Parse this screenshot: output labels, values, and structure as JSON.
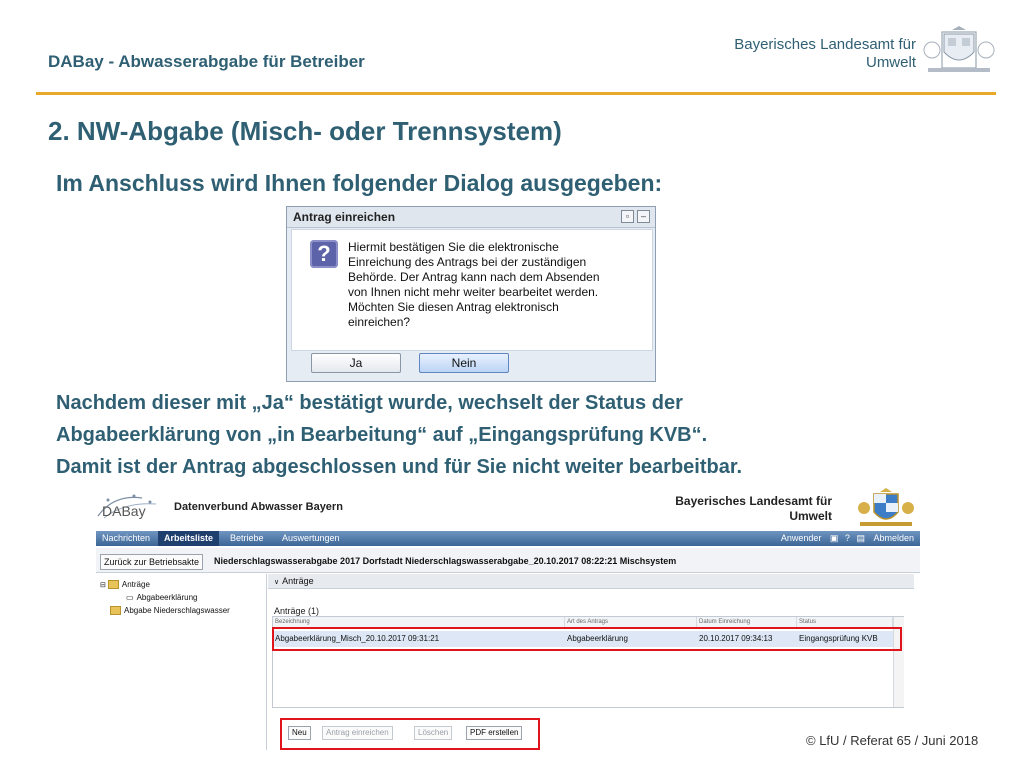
{
  "header": {
    "title": "DABay - Abwasserabgabe für Betreiber",
    "org_line1": "Bayerisches Landesamt für",
    "org_line2": "Umwelt"
  },
  "slide": {
    "heading": "2. NW-Abgabe (Misch- oder Trennsystem)",
    "intro": "Im Anschluss wird Ihnen folgender Dialog ausgegeben:",
    "para_line1": "Nachdem dieser mit „Ja“ bestätigt wurde, wechselt der Status der",
    "para_line2": "Abgabeerklärung von „in Bearbeitung“ auf „Eingangsprüfung KVB“.",
    "para_line3": "Damit ist der Antrag abgeschlossen und für Sie nicht weiter bearbeitbar."
  },
  "dialog": {
    "title": "Antrag einreichen",
    "message": "Hiermit bestätigen Sie die elektronische\nEinreichung des Antrags bei der zuständigen\nBehörde. Der Antrag kann nach dem Absenden\nvon Ihnen nicht mehr weiter bearbeitet werden.\nMöchten Sie diesen Antrag elektronisch\neinreichen?",
    "icon": "question-icon",
    "yes_label": "Ja",
    "no_label": "Nein"
  },
  "app": {
    "logo_text": "DABay",
    "name": "Datenverbund Abwasser Bayern",
    "org_line1": "Bayerisches Landesamt für",
    "org_line2": "Umwelt",
    "nav": [
      "Nachrichten",
      "Arbeitsliste",
      "Betriebe",
      "Auswertungen"
    ],
    "nav_right": {
      "user_label": "Anwender",
      "logout_label": "Abmelden"
    },
    "back_button": "Zurück zur Betriebsakte",
    "path": "Niederschlagswasserabgabe 2017 Dorfstadt Niederschlagswasserabgabe_20.10.2017 08:22:21 Mischsystem",
    "tree": [
      "Anträge",
      "Abgabeerklärung",
      "Abgabe Niederschlagswasser"
    ],
    "panel_title": "Anträge",
    "list_label": "Anträge  (1)",
    "columns": [
      "Bezeichnung",
      "Art des Antrags",
      "Datum Einreichung",
      "Status"
    ],
    "rows": [
      [
        "Abgabeerklärung_Misch_20.10.2017 09:31:21",
        "Abgabeerklärung",
        "20.10.2017 09:34:13",
        "Eingangsprüfung KVB"
      ]
    ],
    "buttons": {
      "neu": "Neu",
      "einreichen": "Antrag einreichen",
      "loeschen": "Löschen",
      "pdf": "PDF erstellen"
    }
  },
  "footer": "© LfU / Referat 65 / Juni 2018",
  "colors": {
    "heading": "#2f5f73",
    "accent": "#e8a82a",
    "highlight": "#e0151b"
  }
}
